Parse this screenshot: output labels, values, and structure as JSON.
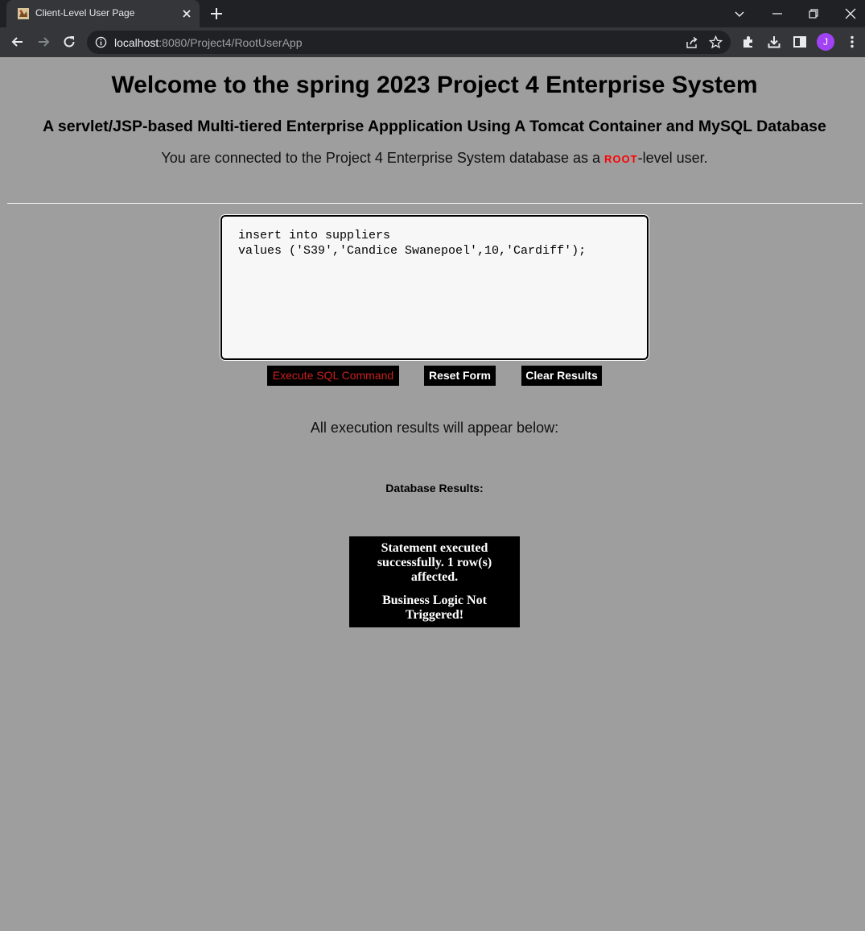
{
  "browser": {
    "tab_title": "Client-Level User Page",
    "url_host": "localhost",
    "url_rest": ":8080/Project4/RootUserApp",
    "profile_initial": "J"
  },
  "page": {
    "title": "Welcome to the spring 2023 Project 4 Enterprise System",
    "subtitle": "A servlet/JSP-based Multi-tiered Enterprise Appplication Using A Tomcat Container and MySQL Database",
    "connection_prefix": "You are connected to the Project 4 Enterprise System database as a ",
    "connection_role": "ROOT",
    "connection_suffix": "-level user.",
    "sql_text": "insert into suppliers\nvalues ('S39','Candice Swanepoel',10,'Cardiff');",
    "buttons": {
      "execute": "Execute SQL Command",
      "reset": "Reset Form",
      "clear": "Clear Results"
    },
    "results_caption": "All execution results will appear below:",
    "db_results_label": "Database Results:",
    "result_lines": [
      "Statement executed successfully. 1 row(s) affected.",
      "Business Logic Not Triggered!"
    ]
  },
  "colors": {
    "page_bg": "#9e9e9e",
    "role_red": "#ff0000",
    "execute_text": "#cc1f1f",
    "chrome_dark": "#202124",
    "chrome_mid": "#35363a",
    "avatar": "#a142f4"
  },
  "icons": [
    "favicon",
    "close-icon",
    "plus-icon",
    "chevron-down-icon",
    "minimize-icon",
    "restore-icon",
    "window-close-icon",
    "back-arrow-icon",
    "forward-arrow-icon",
    "reload-icon",
    "info-icon",
    "share-icon",
    "star-icon",
    "extensions-icon",
    "download-icon",
    "side-panel-icon",
    "kebab-menu-icon"
  ]
}
